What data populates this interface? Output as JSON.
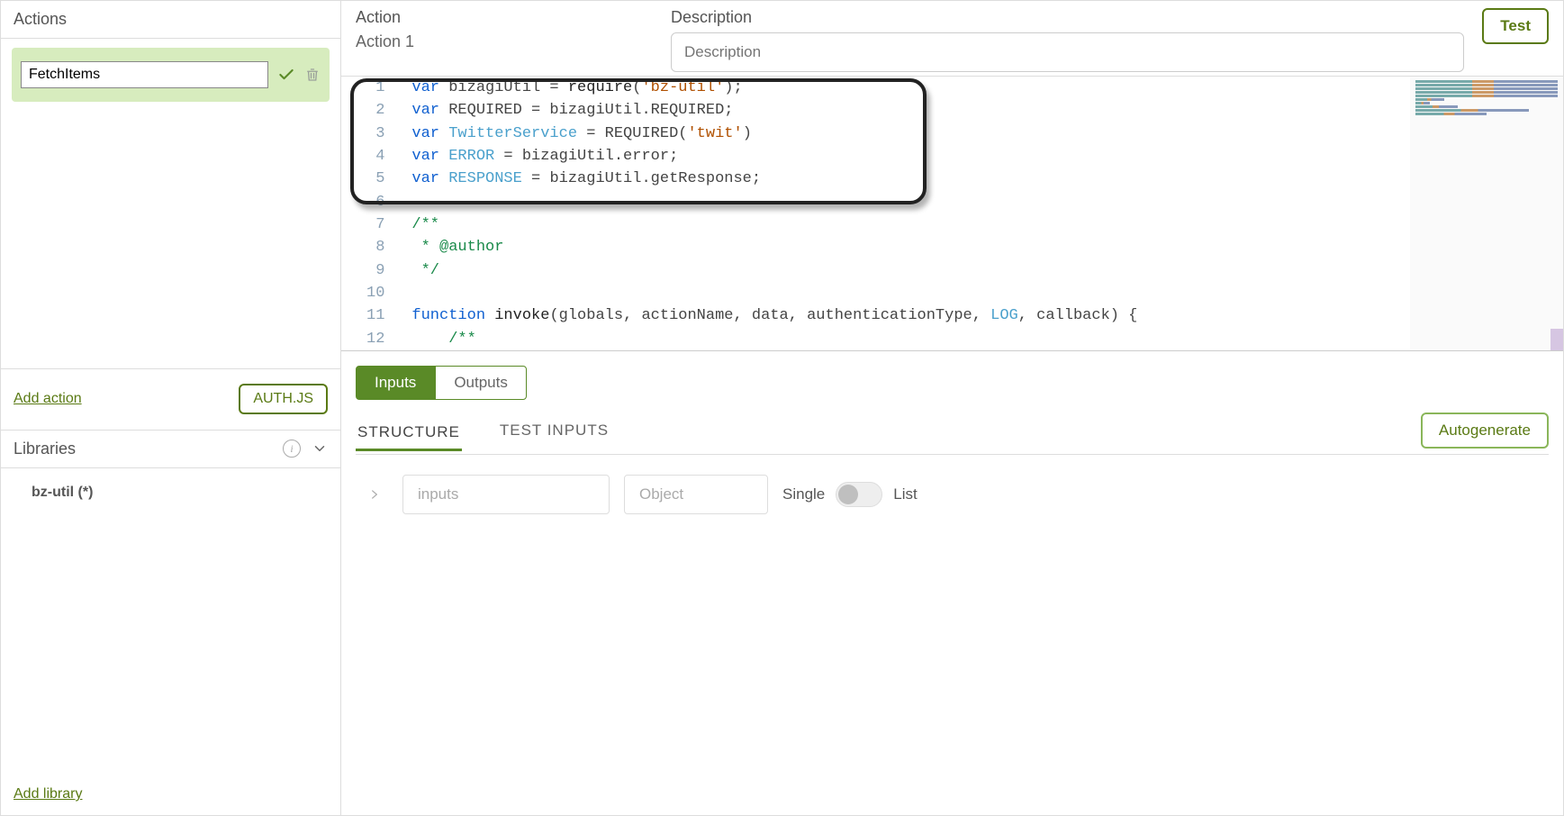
{
  "sidebar": {
    "title": "Actions",
    "action_name": "FetchItems",
    "add_action_label": "Add action",
    "auth_button": "AUTH.JS",
    "libraries_title": "Libraries",
    "library_item": "bz-util (*)",
    "add_library_label": "Add library"
  },
  "header": {
    "action_label": "Action",
    "action_value": "Action 1",
    "description_label": "Description",
    "description_placeholder": "Description",
    "test_button": "Test"
  },
  "code": {
    "lines": [
      {
        "n": 1,
        "html": "<span class='kw'>var</span> bizagiUtil = <span class='id'>require</span>(<span class='str'>'bz-util'</span>);"
      },
      {
        "n": 2,
        "html": "<span class='kw'>var</span> REQUIRED = bizagiUtil.REQUIRED;"
      },
      {
        "n": 3,
        "html": "<span class='kw'>var</span> <span class='var2'>TwitterService</span> = REQUIRED(<span class='str'>'twit'</span>)"
      },
      {
        "n": 4,
        "html": "<span class='kw'>var</span> <span class='var2'>ERROR</span> = bizagiUtil.error;"
      },
      {
        "n": 5,
        "html": "<span class='kw'>var</span> <span class='var2'>RESPONSE</span> = bizagiUtil.getResponse;"
      },
      {
        "n": 6,
        "html": ""
      },
      {
        "n": 7,
        "html": "<span class='cmt'>/**</span>"
      },
      {
        "n": 8,
        "html": "<span class='cmt'> * @author </span>"
      },
      {
        "n": 9,
        "html": "<span class='cmt'> */</span>"
      },
      {
        "n": 10,
        "html": ""
      },
      {
        "n": 11,
        "html": "<span class='kw'>function</span> <span class='id'>invoke</span>(globals, actionName, data, authenticationType, <span class='var2'>LOG</span>, callback) {"
      },
      {
        "n": 12,
        "html": "    <span class='cmt'>/**</span>"
      }
    ]
  },
  "io": {
    "inputs_tab": "Inputs",
    "outputs_tab": "Outputs",
    "structure_tab": "STRUCTURE",
    "test_inputs_tab": "TEST INPUTS",
    "autogenerate": "Autogenerate",
    "inputs_placeholder": "inputs",
    "type_placeholder": "Object",
    "toggle_left": "Single",
    "toggle_right": "List"
  }
}
